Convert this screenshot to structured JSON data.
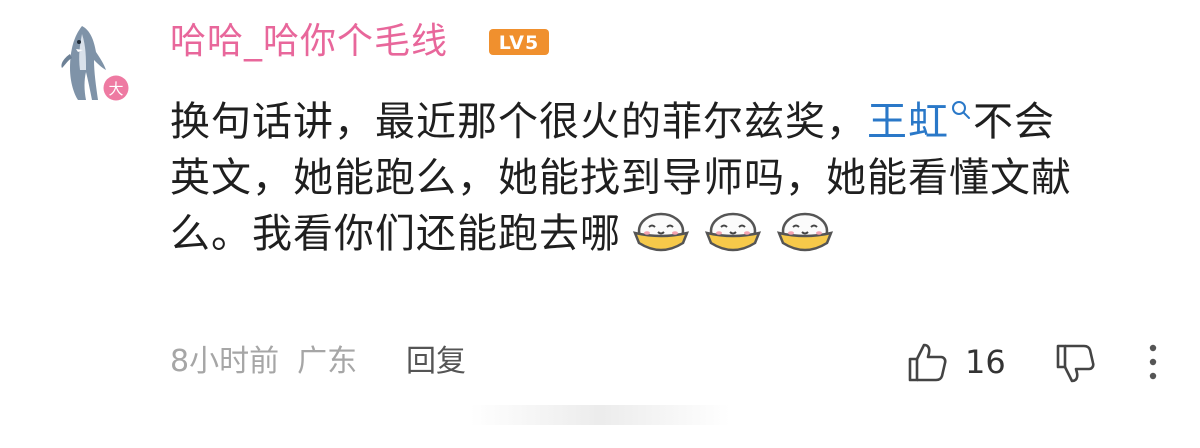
{
  "comment": {
    "username": "哈哈_哈你个毛线",
    "level_badge": "LV5",
    "avatar_badge": "大",
    "line1_before_topic": "换句话讲，最近那个很火的菲尔兹奖，",
    "topic": "王虹",
    "line1_after_topic": "不会",
    "line2": "英文，她能跑么，她能找到导师吗，她能看懂文献",
    "line3": "么。我看你们还能跑去哪",
    "emojis": [
      "bowl-emoji",
      "bowl-emoji",
      "bowl-emoji"
    ]
  },
  "meta": {
    "time": "8小时前",
    "location": "广东",
    "reply_label": "回复"
  },
  "actions": {
    "like_count": "16"
  },
  "colors": {
    "username": "#e8679b",
    "topic_link": "#2a78c8",
    "level_badge": "#f0902e",
    "meta_text": "#a6a6a6"
  }
}
